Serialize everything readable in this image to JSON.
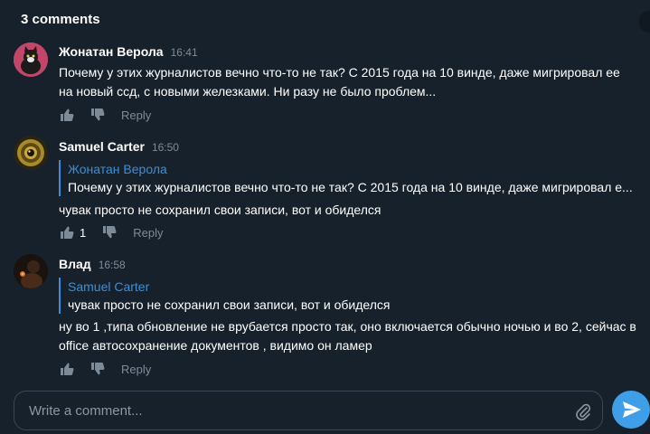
{
  "header": {
    "title": "3 comments"
  },
  "comments": [
    {
      "author": "Жонатан Верола",
      "time": "16:41",
      "text": "Почему у этих журналистов вечно что-то не так? С 2015 года на 10 винде, даже мигрировал ее на новый ссд, с новыми железками. Ни разу не было проблем...",
      "reply": "Reply",
      "avatar_icon": "cat-avatar",
      "avatar_color": "#c2456a"
    },
    {
      "author": "Samuel Carter",
      "time": "16:50",
      "quote_author": "Жонатан Верола",
      "quote_text": "Почему у этих журналистов вечно что-то не так? С 2015 года на 10 винде, даже мигрировал е...",
      "text": "чувак просто не сохранил свои записи, вот и обиделся",
      "likes": "1",
      "reply": "Reply",
      "avatar_icon": "eye-avatar",
      "avatar_color": "#a88a2a"
    },
    {
      "author": "Влад",
      "time": "16:58",
      "quote_author": "Samuel Carter",
      "quote_text": "чувак просто не сохранил свои записи, вот и обиделся",
      "text": "ну во 1 ,типа обновление не врубается просто так, оно включается обычно ночью и во 2, сейчас в office автосохранение документов , видимо он ламер",
      "reply": "Reply",
      "avatar_icon": "dark-figure-avatar",
      "avatar_color": "#3a2418"
    }
  ],
  "composer": {
    "placeholder": "Write a comment..."
  },
  "colors": {
    "background": "#17212b",
    "accent": "#3d8ed8",
    "send_button": "#3e9fe8"
  }
}
